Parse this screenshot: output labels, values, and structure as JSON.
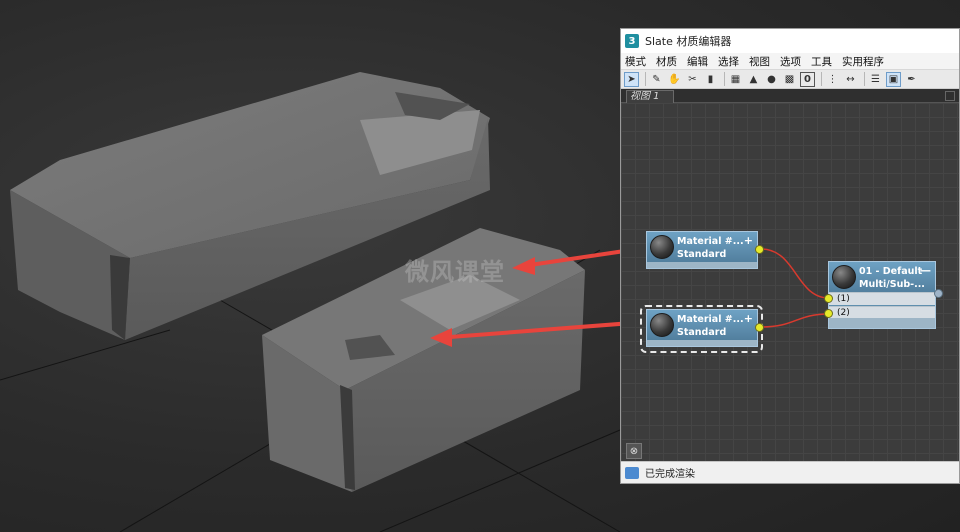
{
  "viewport": {
    "watermark": "微风课堂"
  },
  "window": {
    "app_icon": "3",
    "title": "Slate 材质编辑器",
    "menu": [
      "模式",
      "材质",
      "编辑",
      "选择",
      "视图",
      "选项",
      "工具",
      "实用程序"
    ],
    "toolbar": {
      "items": [
        "select-arrow-icon",
        "eyedropper-icon",
        "hand-icon",
        "scissors-icon",
        "trash-icon",
        "layout-icon",
        "assign-icon",
        "bg-icon",
        "checker-icon",
        "zero-icon",
        "arrange-icon",
        "move-icon",
        "list-icon",
        "render-icon",
        "pen-icon"
      ],
      "zero_label": "0"
    },
    "view_tab": "视图 1",
    "nodes": {
      "material1": {
        "name": "Material #...",
        "type": "Standard",
        "plus": "+"
      },
      "material2": {
        "name": "Material #...",
        "type": "Standard",
        "plus": "+"
      },
      "multi": {
        "name": "01 - Default",
        "type": "Multi/Sub-...",
        "minus": "—",
        "slot1": "(1)",
        "slot2": "(2)"
      }
    },
    "corner_button_icon": "binoculars-icon",
    "status": "已完成渲染"
  },
  "colors": {
    "node_blue": "#5f8fae",
    "wire_red": "#d83a2e",
    "port_yellow": "#e6ea2a",
    "arrow_red": "#e8443c"
  }
}
